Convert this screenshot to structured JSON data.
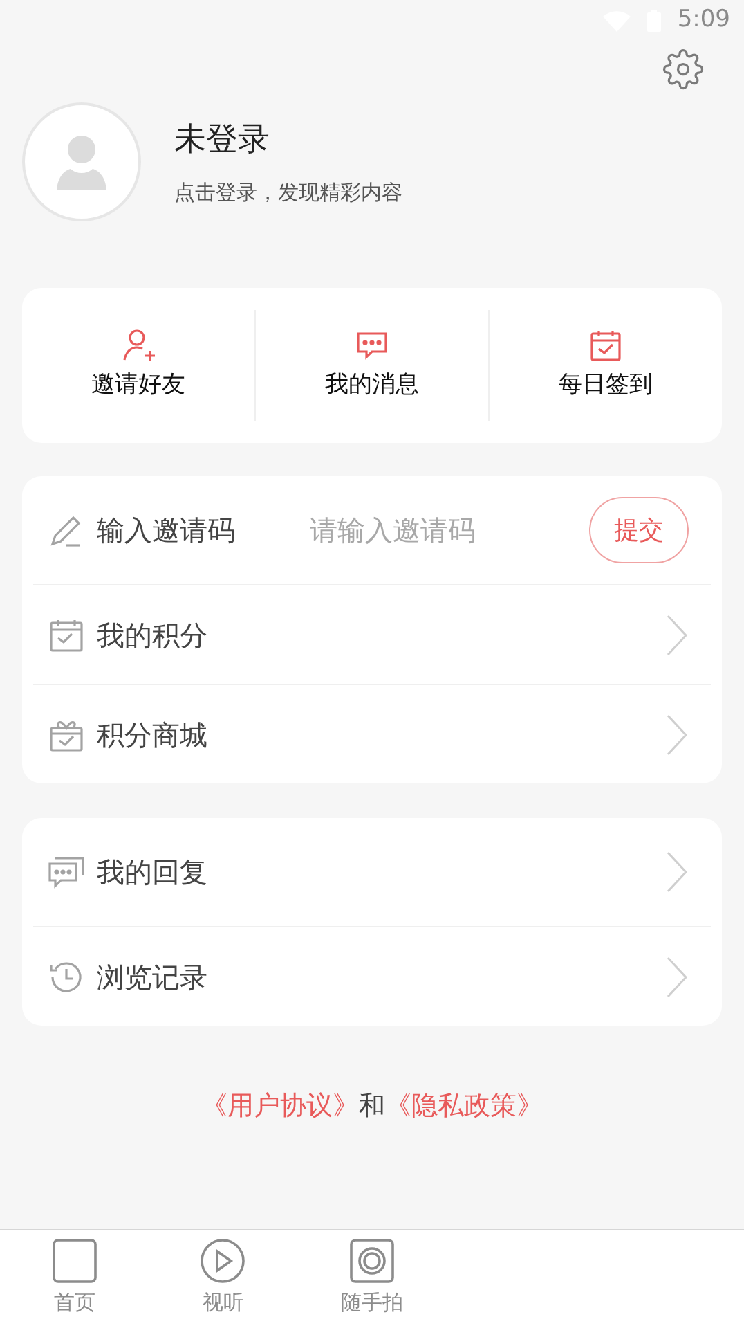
{
  "status_bar": {
    "time": "5:09"
  },
  "profile": {
    "name": "未登录",
    "subtitle": "点击登录，发现精彩内容"
  },
  "shortcuts": [
    {
      "label": "邀请好友"
    },
    {
      "label": "我的消息"
    },
    {
      "label": "每日签到"
    }
  ],
  "menu_groups": [
    [
      {
        "kind": "input",
        "label": "输入邀请码",
        "placeholder": "请输入邀请码",
        "button": "提交"
      },
      {
        "kind": "link",
        "label": "我的积分"
      },
      {
        "kind": "link",
        "label": "积分商城"
      }
    ],
    [
      {
        "kind": "link",
        "label": "我的回复"
      },
      {
        "kind": "link",
        "label": "浏览记录"
      }
    ]
  ],
  "agreement": {
    "link_1": "《用户协议》",
    "joiner": "和",
    "link_2": "《隐私政策》"
  },
  "tab_bar": [
    {
      "label": "首页",
      "selected": false
    },
    {
      "label": "视听",
      "selected": false
    },
    {
      "label": "随手拍",
      "selected": false
    }
  ]
}
